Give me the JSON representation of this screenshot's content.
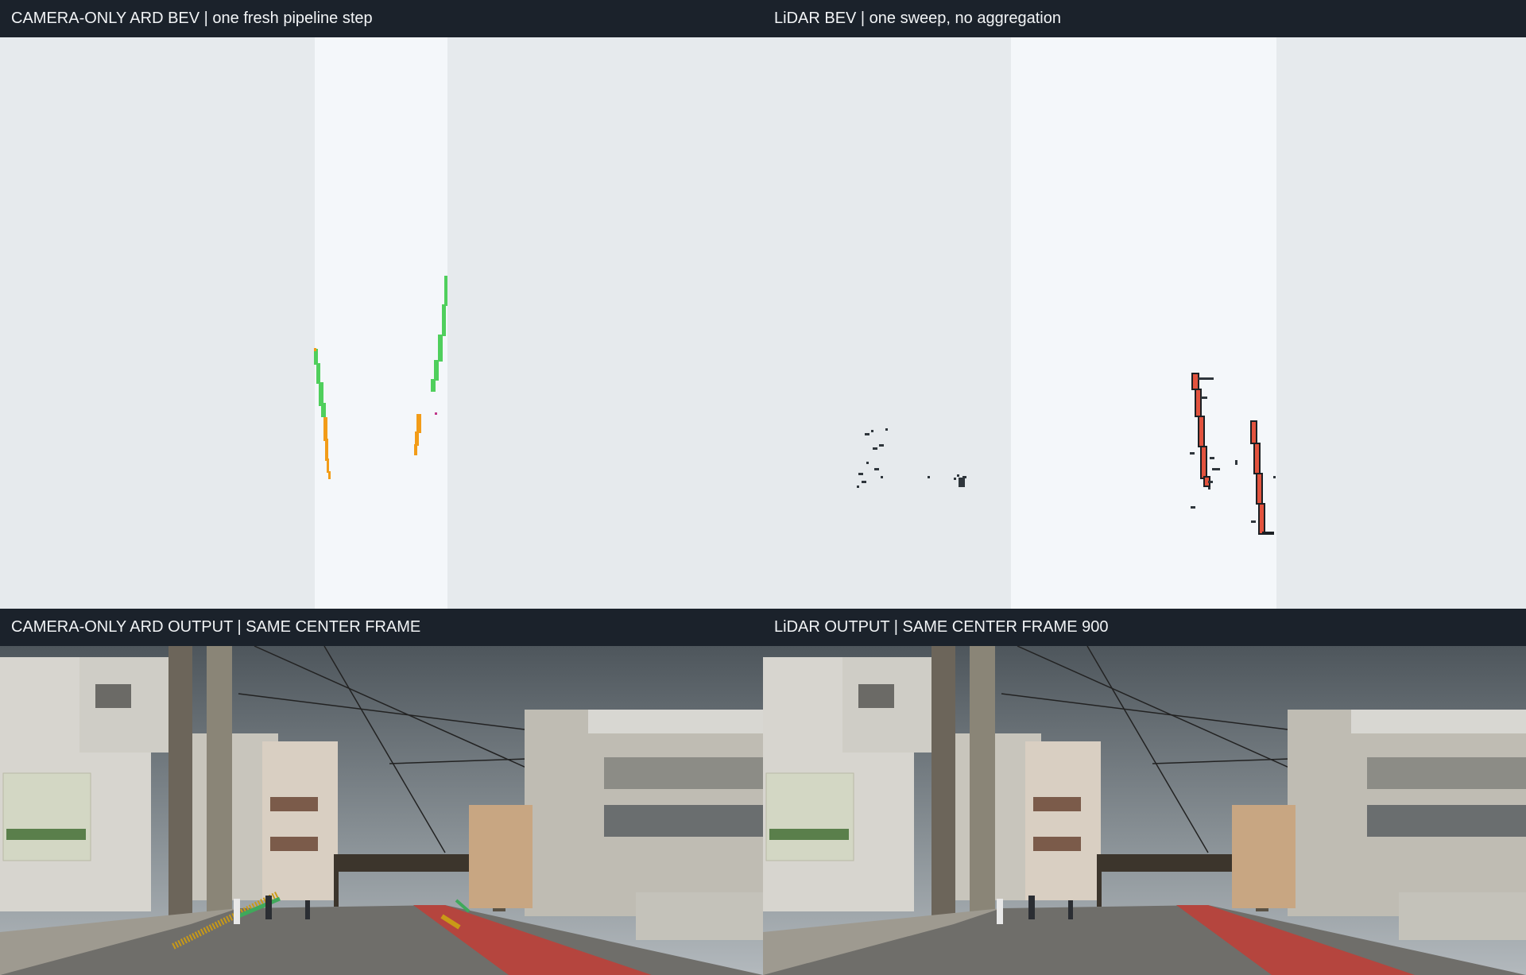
{
  "panels": {
    "camera_bev": {
      "title": "CAMERA-ONLY ARD BEV | one fresh pipeline step"
    },
    "lidar_bev": {
      "title": "LiDAR BEV | one sweep, no aggregation"
    },
    "camera_output": {
      "title": "CAMERA-ONLY ARD OUTPUT | SAME CENTER FRAME"
    },
    "lidar_output": {
      "title": "LiDAR OUTPUT | SAME CENTER FRAME 900"
    }
  },
  "colors": {
    "header_bg": "#1b222b",
    "header_text": "#f2f4f6",
    "bev_background": "#e6eaed",
    "bev_valid_region": "#f4f7fa",
    "lane_green": "#4fcf5c",
    "lane_orange": "#f29c18",
    "lidar_curb_red": "#e2533e",
    "lidar_points": "#2f363c",
    "road_red": "#b5453e"
  }
}
